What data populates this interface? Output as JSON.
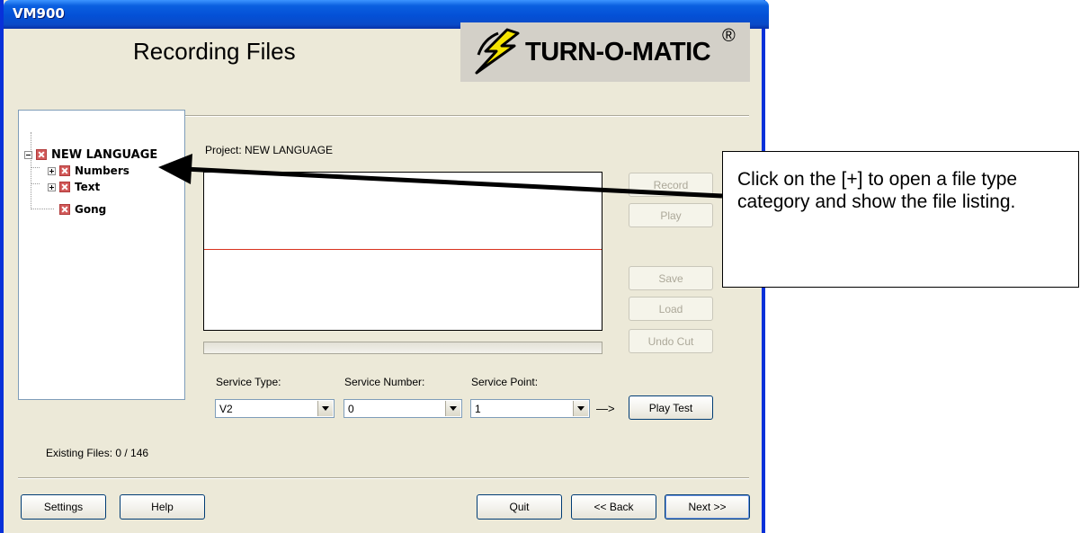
{
  "window": {
    "title": "VM900"
  },
  "header": {
    "page_title": "Recording Files",
    "logo_text": "TURN-O-MATIC",
    "logo_reg": "®"
  },
  "tree": {
    "root": "NEW LANGUAGE",
    "items": [
      {
        "label": "Numbers",
        "expandable": true
      },
      {
        "label": "Text",
        "expandable": true
      },
      {
        "label": "Gong",
        "expandable": false
      }
    ]
  },
  "project_label": "Project: NEW LANGUAGE",
  "buttons": {
    "record": "Record",
    "play": "Play",
    "save": "Save",
    "load": "Load",
    "undo_cut": "Undo Cut",
    "play_test": "Play Test",
    "settings": "Settings",
    "help": "Help",
    "quit": "Quit",
    "back": "<< Back",
    "next": "Next >>"
  },
  "service": {
    "type_label": "Service Type:",
    "type_value": "V2",
    "number_label": "Service Number:",
    "number_value": "0",
    "point_label": "Service Point:",
    "point_value": "1",
    "arrow": "—>"
  },
  "existing_files": "Existing Files: 0 / 146",
  "callout": {
    "text": "Click on the [+] to open a file type category and show the file listing."
  },
  "colors": {
    "titlebar": "#0450d6",
    "waveform_line": "#d9341f",
    "logo_bolt": "#f5e500"
  }
}
